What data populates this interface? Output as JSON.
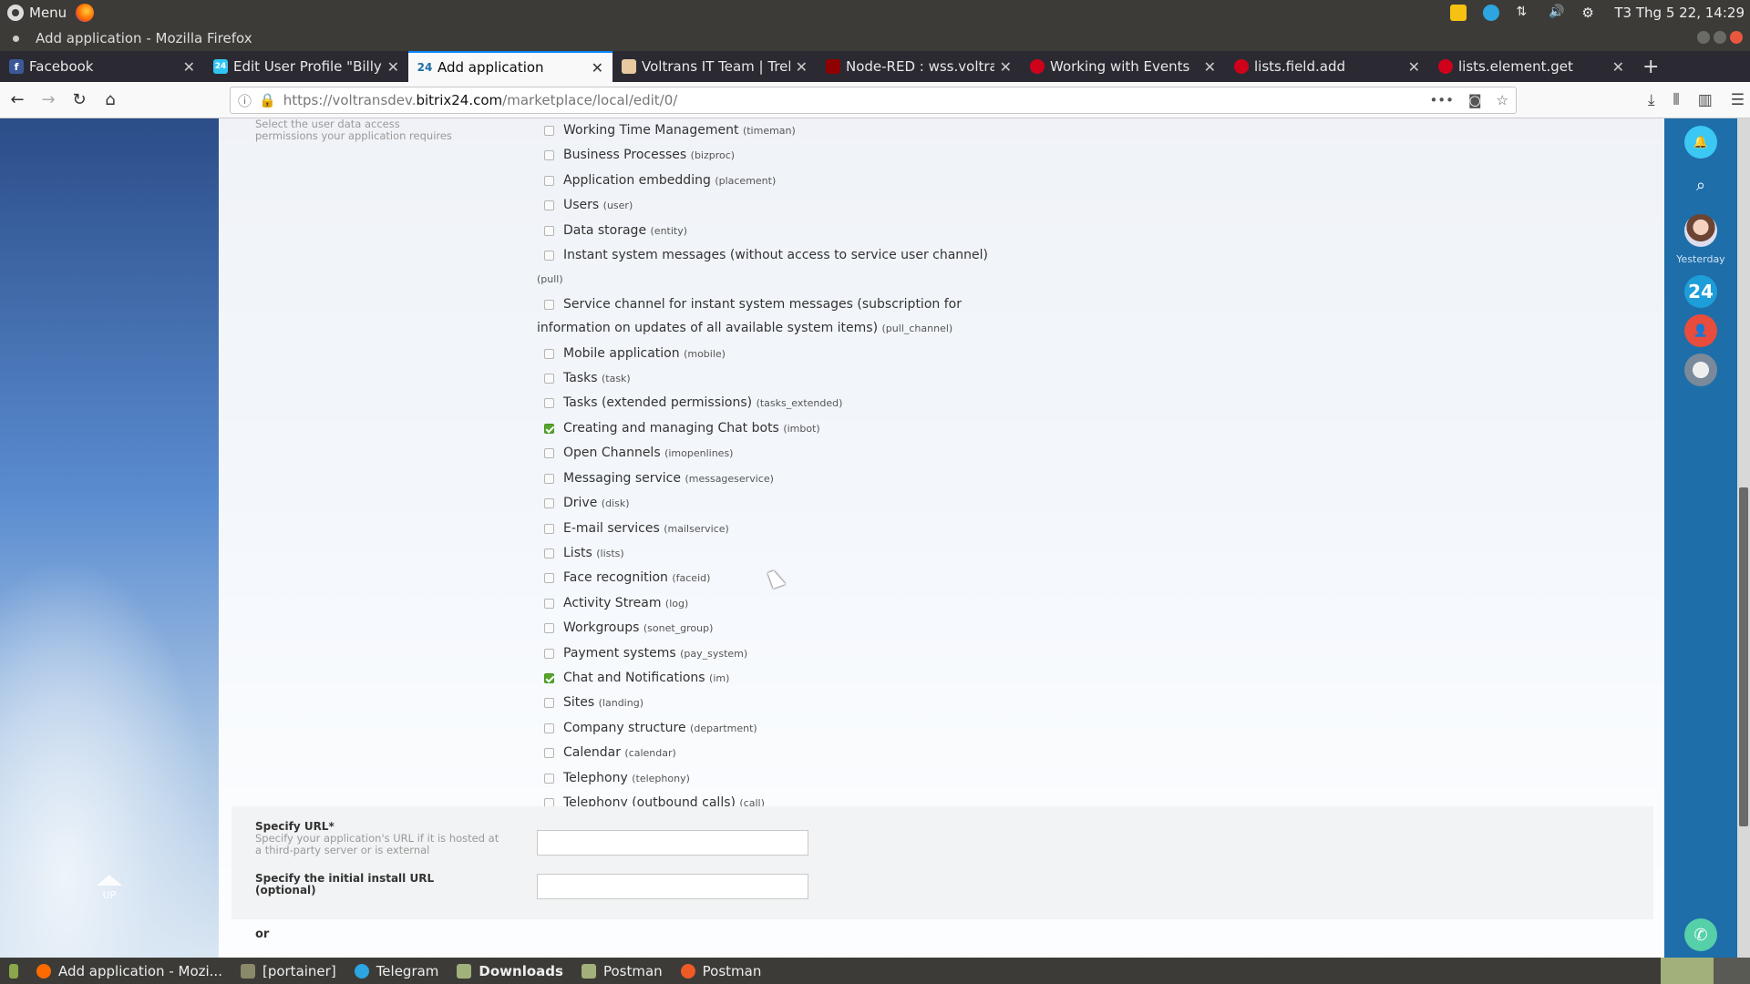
{
  "system": {
    "menu_label": "Menu",
    "clock": "T3 Thg 5 22, 14:29"
  },
  "window": {
    "title": "Add application - Mozilla Firefox"
  },
  "tabs": [
    {
      "label": "Facebook",
      "icon": "facebook-icon",
      "active": false
    },
    {
      "label": "Edit User Profile \"Billy V",
      "icon": "bitrix24-icon",
      "active": false
    },
    {
      "label": "Add application",
      "icon": "bitrix24-icon",
      "active": true
    },
    {
      "label": "Voltrans IT Team | Trello",
      "icon": "trello-icon",
      "active": false
    },
    {
      "label": "Node-RED : wss.voltrans",
      "icon": "node-red-icon",
      "active": false
    },
    {
      "label": "Working with Events",
      "icon": "bitrix-doc-icon",
      "active": false
    },
    {
      "label": "lists.field.add",
      "icon": "bitrix-doc-icon",
      "active": false
    },
    {
      "label": "lists.element.get",
      "icon": "bitrix-doc-icon",
      "active": false
    }
  ],
  "address_bar": {
    "url_prefix": "https://voltransdev.",
    "url_domain": "bitrix24.com",
    "url_path": "/marketplace/local/edit/0/"
  },
  "form": {
    "permissions_hint": "Select the user data access permissions your application requires",
    "permissions": [
      {
        "label": "Working Time Management",
        "code": "(timeman)",
        "checked": false
      },
      {
        "label": "Business Processes",
        "code": "(bizproc)",
        "checked": false
      },
      {
        "label": "Application embedding",
        "code": "(placement)",
        "checked": false
      },
      {
        "label": "Users",
        "code": "(user)",
        "checked": false
      },
      {
        "label": "Data storage",
        "code": "(entity)",
        "checked": false
      },
      {
        "label": "Instant system messages (without access to service user channel)",
        "code": "(pull)",
        "checked": false
      },
      {
        "label": "Service channel for instant system messages (subscription for information on updates of all available system items)",
        "code": "(pull_channel)",
        "checked": false
      },
      {
        "label": "Mobile application",
        "code": "(mobile)",
        "checked": false
      },
      {
        "label": "Tasks",
        "code": "(task)",
        "checked": false
      },
      {
        "label": "Tasks (extended permissions)",
        "code": "(tasks_extended)",
        "checked": false
      },
      {
        "label": "Creating and managing Chat bots",
        "code": "(imbot)",
        "checked": true
      },
      {
        "label": "Open Channels",
        "code": "(imopenlines)",
        "checked": false
      },
      {
        "label": "Messaging service",
        "code": "(messageservice)",
        "checked": false
      },
      {
        "label": "Drive",
        "code": "(disk)",
        "checked": false
      },
      {
        "label": "E-mail services",
        "code": "(mailservice)",
        "checked": false
      },
      {
        "label": "Lists",
        "code": "(lists)",
        "checked": false
      },
      {
        "label": "Face recognition",
        "code": "(faceid)",
        "checked": false
      },
      {
        "label": "Activity Stream",
        "code": "(log)",
        "checked": false
      },
      {
        "label": "Workgroups",
        "code": "(sonet_group)",
        "checked": false
      },
      {
        "label": "Payment systems",
        "code": "(pay_system)",
        "checked": false
      },
      {
        "label": "Chat and Notifications",
        "code": "(im)",
        "checked": true
      },
      {
        "label": "Sites",
        "code": "(landing)",
        "checked": false
      },
      {
        "label": "Company structure",
        "code": "(department)",
        "checked": false
      },
      {
        "label": "Calendar",
        "code": "(calendar)",
        "checked": false
      },
      {
        "label": "Telephony",
        "code": "(telephony)",
        "checked": false
      },
      {
        "label": "Telephony (outbound calls)",
        "code": "(call)",
        "checked": false
      }
    ],
    "url_label": "Specify URL*",
    "url_hint": "Specify your application's URL if it is hosted at a third-party server or is external",
    "url_value": "",
    "install_url_label": "Specify the initial install URL (optional)",
    "install_url_value": "",
    "or_text": "or",
    "up_label": "UP"
  },
  "right_bar": {
    "yesterday_label": "Yesterday",
    "b24_label": "24"
  },
  "taskbar": [
    {
      "label": "Add application - Mozi...",
      "icon": "firefox-icon",
      "bold": false
    },
    {
      "label": "[portainer]",
      "icon": "folder-icon",
      "bold": false
    },
    {
      "label": "Telegram",
      "icon": "telegram-icon",
      "bold": false
    },
    {
      "label": "Downloads",
      "icon": "folder-icon",
      "bold": true
    },
    {
      "label": "Postman",
      "icon": "folder-icon",
      "bold": false
    },
    {
      "label": "Postman",
      "icon": "postman-icon",
      "bold": false
    }
  ]
}
